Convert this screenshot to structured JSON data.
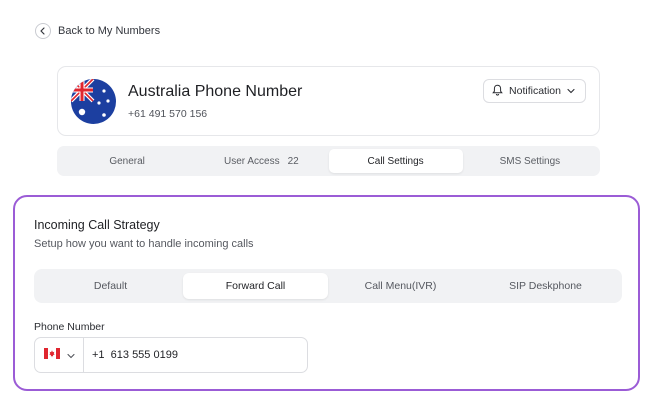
{
  "nav": {
    "back_label": "Back to My Numbers"
  },
  "number": {
    "title": "Australia Phone Number",
    "phone": "+61 491 570 156",
    "notification_label": "Notification"
  },
  "tabs": [
    {
      "label": "General",
      "count": ""
    },
    {
      "label": "User Access",
      "count": "22"
    },
    {
      "label": "Call Settings",
      "count": ""
    },
    {
      "label": "SMS Settings",
      "count": ""
    }
  ],
  "active_tab": "Call Settings",
  "strategy": {
    "title": "Incoming Call Strategy",
    "subtitle": "Setup how you want to handle incoming calls",
    "options": [
      "Default",
      "Forward Call",
      "Call Menu(IVR)",
      "SIP Deskphone"
    ],
    "active_option": "Forward Call",
    "phone_label": "Phone Number",
    "country_code": "+1",
    "phone_value": "+1  613 555 0199"
  },
  "colors": {
    "highlight_border": "#9b5cd6",
    "flag_blue": "#1c3fa0",
    "flag_red": "#e0262f"
  },
  "icons": [
    "chevron-left-icon",
    "australia-flag-icon",
    "bell-icon",
    "chevron-down-icon",
    "canada-flag-icon"
  ]
}
